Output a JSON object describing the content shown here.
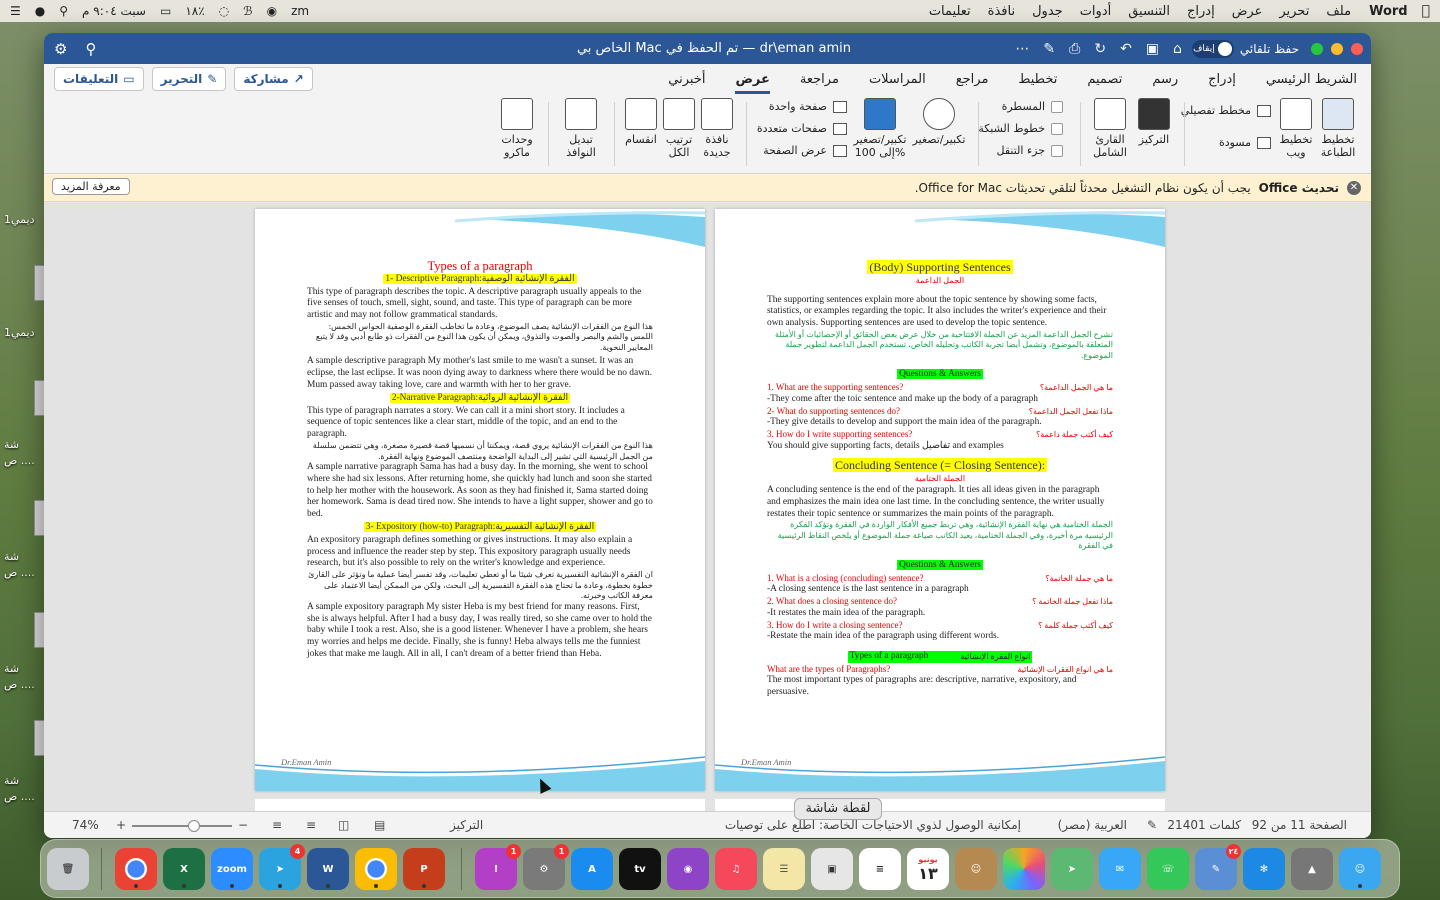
{
  "menubar": {
    "app": "Word",
    "items": [
      "ملف",
      "تحرير",
      "عرض",
      "إدراج",
      "التنسيق",
      "أدوات",
      "جدول",
      "نافذة",
      "تعليمات"
    ],
    "clock": "سبت ٩:٠٤ م",
    "battery": "٪١٨",
    "zm": "zm"
  },
  "window": {
    "title": "dr\\eman amin — تم الحفظ في Mac الخاص بي",
    "autosave_label": "حفظ تلقائي",
    "autosave_state": "إيقاف"
  },
  "tabs": [
    "الشريط الرئيسي",
    "إدراج",
    "رسم",
    "تصميم",
    "تخطيط",
    "مراجع",
    "المراسلات",
    "مراجعة",
    "عرض",
    "أخبرني"
  ],
  "active_tab": "عرض",
  "actions": {
    "share": "مشاركة",
    "edit": "التحرير",
    "comments": "التعليقات"
  },
  "ribbon": {
    "print_layout": "تخطيط الطباعة",
    "web_layout": "تخطيط ويب",
    "outline": "مخطط تفصيلي",
    "draft": "مسودة",
    "focus": "التركيز",
    "immersive": "القارئ الشامل",
    "ruler": "المسطرة",
    "gridlines": "خطوط الشبكة",
    "nav_pane": "جزء التنقل",
    "zoom": "تكبير/تصغير",
    "zoom100": "تكبير/تصغير إلى 100%",
    "one_page": "صفحة واحدة",
    "multi_page": "صفحات متعددة",
    "page_width": "عرض الصفحة",
    "new_window": "نافذة جديدة",
    "arrange_all": "ترتيب الكل",
    "split": "انقسام",
    "switch_windows": "تبديل النوافذ",
    "macros": "وحدات ماكرو"
  },
  "infobar": {
    "title": "تحديث Office",
    "message": "يجب أن يكون نظام التشغيل محدثاً لتلقي تحديثات Office for Mac.",
    "button": "معرفة المزيد"
  },
  "page_left": {
    "title": "Types of a paragraph",
    "h1": "1- Descriptive Paragraph:الفقرة الإنشائية الوصفية",
    "p1": "This type of paragraph describes the topic. A descriptive paragraph usually appeals to the five senses of touch, smell, sight, sound, and taste. This type of paragraph can be more artistic and may not follow grammatical standards.",
    "a1": "هذا النوع من الفقرات الإنشائية يصف الموضوع، وعادة ما تخاطب الفقرة الوصفية الحواس الخمس: اللمس والشم والبصر والصوت والتذوق، ويمكن أن يكون هذا النوع من الفقرات ذو طابع أدبي وقد لا يتبع المعايير النحوية.",
    "s1": "A sample descriptive paragraph My mother's last smile to me wasn't a sunset. It was an eclipse, the last eclipse. It was noon dying away to darkness where there would be no dawn. Mum passed away taking love, care and warmth with her to her grave.",
    "h2": "2-Narrative Paragraph:الفقرة الإنشائية الروائية",
    "p2": "This type of paragraph narrates a story. We can call it a mini short story. It includes a sequence of topic sentences like a clear start, middle of the topic, and an end to the paragraph.",
    "a2": "هذا النوع من الفقرات الإنشائية يروي قصة، ويمكننا أن نسميها قصة قصيرة مصغرة، وهي تتضمن سلسلة من الجمل الرئيسية التي تشير إلى البداية الواضحة ومنتصف الموضوع ونهاية الفقرة.",
    "s2": "A sample narrative paragraph Sama has had a busy day. In the morning, she went to school where she had six lessons. After returning home, she quickly had lunch and soon she started to help her mother with the housework. As soon as they had finished it, Sama started doing her homework. Sama is dead tired now. She intends to have a light supper, shower and go to bed.",
    "h3": "3- Expository (how-to) Paragraph:الفقرة الإنشائية التفسيرية",
    "p3": "An expository paragraph defines something or gives instructions. It may also explain a process and influence the reader step by step. This expository paragraph usually needs research, but it's also possible to rely on the writer's knowledge and experience.",
    "a3": "ان الفقرة الإنشائية التفسيرية تعرف شيئا ما أو تعطي تعليمات، وقد تفسر أيضا عملية ما وتؤثر على القارئ خطوة بخطوة، وعادة ما تحتاج هذه الفقرة التفسيرية إلى البحث، ولكن من الممكن أيضا الاعتماد على معرفة الكاتب وخبرته.",
    "s3": "A sample expository paragraph My sister Heba is my best friend for many reasons. First, she is always helpful. After I had a busy day, I was really tired, so she came over to hold the baby while I took a rest. Also, she is a good listener. Whenever I have a problem, she hears my worries and helps me decide. Finally, she is funny! Heba always tells me the funniest jokes that make me laugh. All in all, I can't dream of a better friend than Heba.",
    "signature": "Dr.Eman Amin"
  },
  "page_right": {
    "title": "(Body) Supporting Sentences",
    "title_ar": "الجمل الداعمة",
    "p1": "The supporting sentences explain more about the topic sentence by showing some facts, statistics, or examples regarding the topic. It also includes the writer's experience and their own analysis. Supporting sentences are used to develop the topic sentence.",
    "a1": "تشرح الجمل الداعمة المزيد عن الجملة الافتتاحية من خلال عرض بعض الحقائق أو الإحصائيات أو الأمثلة المتعلقة بالموضوع، وتشمل أيضا تجربة الكاتب وتحليله الخاص، تستخدم الجمل الداعمة لتطوير جملة الموضوع.",
    "qa1_title": "Questions & Answers",
    "q1": "1.  What are the supporting sentences?",
    "q1_ar": "ما هي الجمل الداعمة؟",
    "ans1": "-They come after the toic sentence and make up the body of a paragraph",
    "q2": "2-  What do supporting sentences do?",
    "q2_ar": "ماذا تفعل الجمل الداعمة؟",
    "ans2": "-They give details to develop and support the main idea of the paragraph.",
    "q3": "3.  How do I write supporting sentences?",
    "q3_ar": "كيف أكتب جملة داعمة؟",
    "ans3": "You should give supporting facts, details تفاصيل and examples",
    "concl_title": "Concluding Sentence (= Closing Sentence):",
    "concl_ar": "الجملة الختامية",
    "p2": "A concluding sentence is the end of the paragraph. It ties all ideas given in the paragraph and emphasizes the main idea one last time. In the concluding sentence, the writer usually restates their topic sentence or summarizes the main points of the paragraph.",
    "a2": "الجملة الختامية هي نهاية الفقرة الإنشائية، وهي تربط جميع الأفكار الواردة في الفقرة وتؤكد الفكرة الرئيسية مرة أخيرة، وفي الجملة الختامية، يعيد الكاتب صياغة جملة الموضوع أو يلخص النقاط الرئيسية في الفقرة",
    "qa2_title": "Questions & Answers",
    "q4": "1. What is a closing (concluding) sentence?",
    "q4_ar": "ما هي جملة الخاتمة؟",
    "ans4": "-A closing sentence is the last sentence in a paragraph",
    "q5": "2. What does a closing sentence do?",
    "q5_ar": "ماذا تفعل جملة الخاتمة ؟",
    "ans5": "-It restates the main idea of the paragraph.",
    "q6": "3. How do I write a closing sentence?",
    "q6_ar": "كيف أكتب جملة كلمة ؟",
    "ans6": "-Restate the main idea of the paragraph using different words.",
    "types_title": "Types of a paragraph",
    "types_ar": "انواع الفقرة الإنشائية",
    "q7": "What are the types of Paragraphs?",
    "q7_ar": "ما هي انواع الفقرات الإنشائية",
    "ans7": "The most important types of paragraphs are: descriptive, narrative, expository, and persuasive.",
    "signature": "Dr.Eman Amin"
  },
  "status": {
    "page": "الصفحة 11 من 92",
    "words": "21401 كلمات",
    "language": "العربية (مصر)",
    "accessibility": "إمكانية الوصول لذوي الاحتياجات الخاصة: اطلع على توصيات",
    "focus": "التركيز",
    "zoom": "74%"
  },
  "tooltip": "لقطة شاشة",
  "desktop": {
    "label1": "ديمي1",
    "label2": "ديمي1",
    "label3": "شة",
    "label4": "ص ....",
    "label5": "شة",
    "label6": "ص ....",
    "label7": "شة",
    "label8": "ص ....",
    "label9": "شة",
    "label10": "ص ...."
  },
  "dock": {
    "zoom": "zoom",
    "telegram_badge": "4",
    "calendar_month": "يونيو",
    "calendar_day": "١٣",
    "notif_badge": "1",
    "settings_badge": "1",
    "reminders_badge": "٢٤"
  }
}
